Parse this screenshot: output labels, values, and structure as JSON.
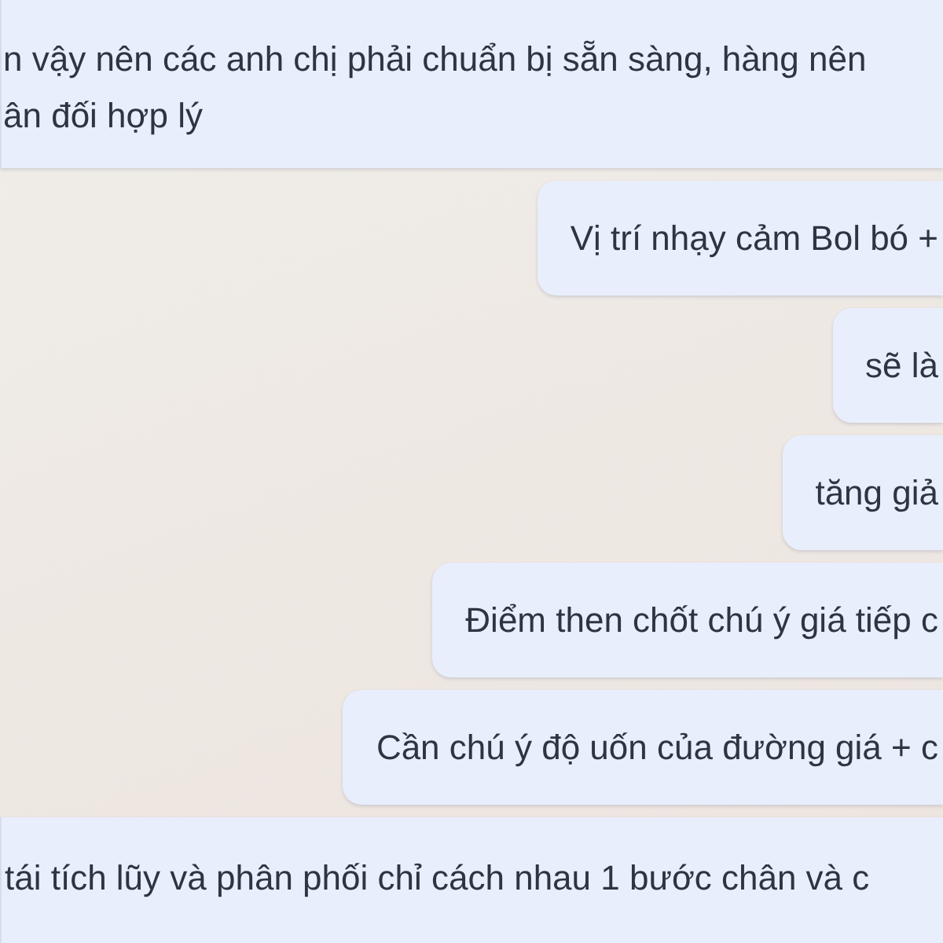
{
  "messages": [
    {
      "kind": "received",
      "text": "n vậy nên các anh chị phải chuẩn bị sẵn sàng, hàng nên\nân đối hợp lý"
    },
    {
      "kind": "sent",
      "text": "Vị trí nhạy cảm Bol bó +"
    },
    {
      "kind": "sent",
      "text": "sẽ là"
    },
    {
      "kind": "sent",
      "text": "tăng giả"
    },
    {
      "kind": "sent",
      "text": "Điểm then chốt chú ý giá tiếp c"
    },
    {
      "kind": "sent",
      "text": "Cần chú ý độ uốn của đường giá + c"
    },
    {
      "kind": "received",
      "text": "tái tích lũy và phân phối chỉ cách nhau 1 bước chân và c"
    }
  ]
}
